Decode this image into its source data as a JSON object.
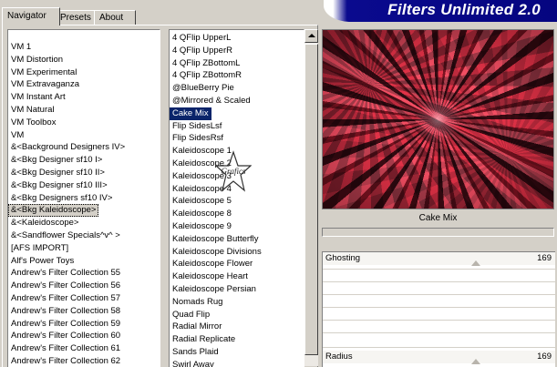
{
  "tabs": [
    {
      "label": "Navigator",
      "active": true
    },
    {
      "label": "Presets",
      "active": false
    },
    {
      "label": "About",
      "active": false
    }
  ],
  "logo": {
    "text": "Filters Unlimited 2.0"
  },
  "categories": [
    "VM 1",
    "VM Distortion",
    "VM Experimental",
    "VM Extravaganza",
    "VM Instant Art",
    "VM Natural",
    "VM Toolbox",
    "VM",
    "&<Background Designers IV>",
    "&<Bkg Designer sf10 I>",
    "&<Bkg Designer sf10 II>",
    "&<Bkg Designer sf10 III>",
    "&<Bkg Designers sf10 IV>",
    "&<Bkg Kaleidoscope>",
    "&<Kaleidoscope>",
    "&<Sandflower Specials^v^ >",
    "[AFS IMPORT]",
    "Alf's Power Toys",
    "Andrew's Filter Collection 55",
    "Andrew's Filter Collection 56",
    "Andrew's Filter Collection 57",
    "Andrew's Filter Collection 58",
    "Andrew's Filter Collection 59",
    "Andrew's Filter Collection 60",
    "Andrew's Filter Collection 61",
    "Andrew's Filter Collection 62"
  ],
  "selected_category": "&<Bkg Kaleidoscope>",
  "filters": [
    "4 QFlip UpperL",
    "4 QFlip UpperR",
    "4 QFlip ZBottomL",
    "4 QFlip ZBottomR",
    "@BlueBerry Pie",
    "@Mirrored & Scaled",
    "Cake Mix",
    "Flip SidesLsf",
    "Flip SidesRsf",
    "Kaleidoscope 1",
    "Kaleidoscope 2",
    "Kaleidoscope 3",
    "Kaleidoscope 4",
    "Kaleidoscope 5",
    "Kaleidoscope 8",
    "Kaleidoscope 9",
    "Kaleidoscope Butterfly",
    "Kaleidoscope Divisions",
    "Kaleidoscope Flower",
    "Kaleidoscope Heart",
    "Kaleidoscope Persian",
    "Nomads Rug",
    "Quad Flip",
    "Radial Mirror",
    "Radial Replicate",
    "Sands Plaid",
    "Swirl Away"
  ],
  "selected_filter": "Cake Mix",
  "preview": {
    "label": "Cake Mix"
  },
  "controls": [
    {
      "label": "Ghosting",
      "value": "169",
      "fraction": 0.66
    },
    {
      "label": "Radius",
      "value": "169",
      "fraction": 0.66
    }
  ],
  "watermark": {
    "text": "Grafics"
  }
}
